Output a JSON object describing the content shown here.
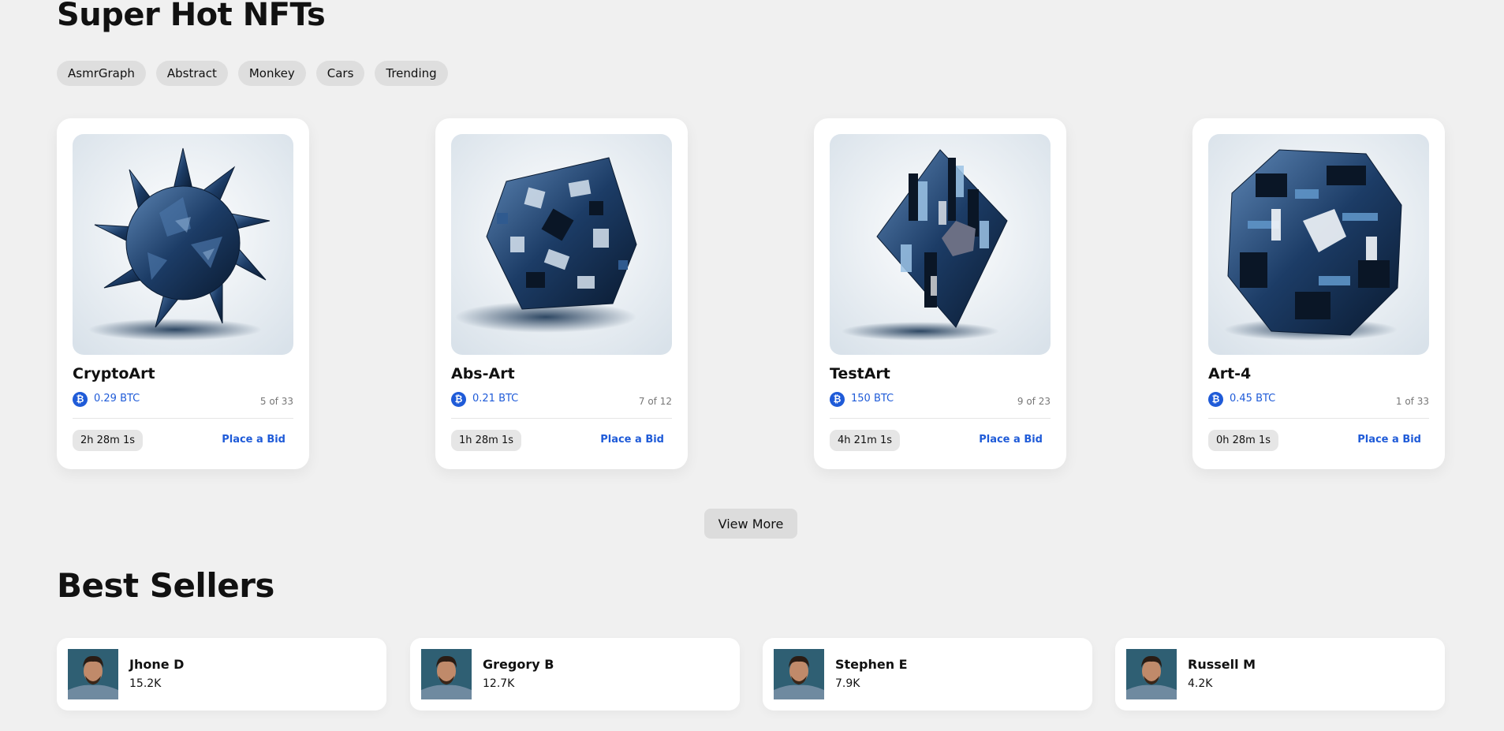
{
  "hot_section": {
    "title": "Super Hot NFTs",
    "filters": [
      "AsmrGraph",
      "Abstract",
      "Monkey",
      "Cars",
      "Trending"
    ],
    "currency_icon": "bitcoin-icon",
    "cards": [
      {
        "name": "CryptoArt",
        "price": "0.29 BTC",
        "edition": "5 of 33",
        "timer": "2h 28m 1s",
        "bid_label": "Place a Bid"
      },
      {
        "name": "Abs-Art",
        "price": "0.21 BTC",
        "edition": "7 of 12",
        "timer": "1h 28m 1s",
        "bid_label": "Place a Bid"
      },
      {
        "name": "TestArt",
        "price": "150 BTC",
        "edition": "9 of 23",
        "timer": "4h 21m 1s",
        "bid_label": "Place a Bid"
      },
      {
        "name": "Art-4",
        "price": "0.45 BTC",
        "edition": "1 of 33",
        "timer": "0h 28m 1s",
        "bid_label": "Place a Bid"
      }
    ],
    "view_more_label": "View More"
  },
  "best_sellers": {
    "title": "Best Sellers",
    "sellers": [
      {
        "name": "Jhone D",
        "amount": "15.2K"
      },
      {
        "name": "Gregory B",
        "amount": "12.7K"
      },
      {
        "name": "Stephen E",
        "amount": "7.9K"
      },
      {
        "name": "Russell M",
        "amount": "4.2K"
      }
    ]
  },
  "colors": {
    "background": "#f0f0f0",
    "accent": "#1f5bd8",
    "chip": "#dedede",
    "card": "#ffffff"
  }
}
